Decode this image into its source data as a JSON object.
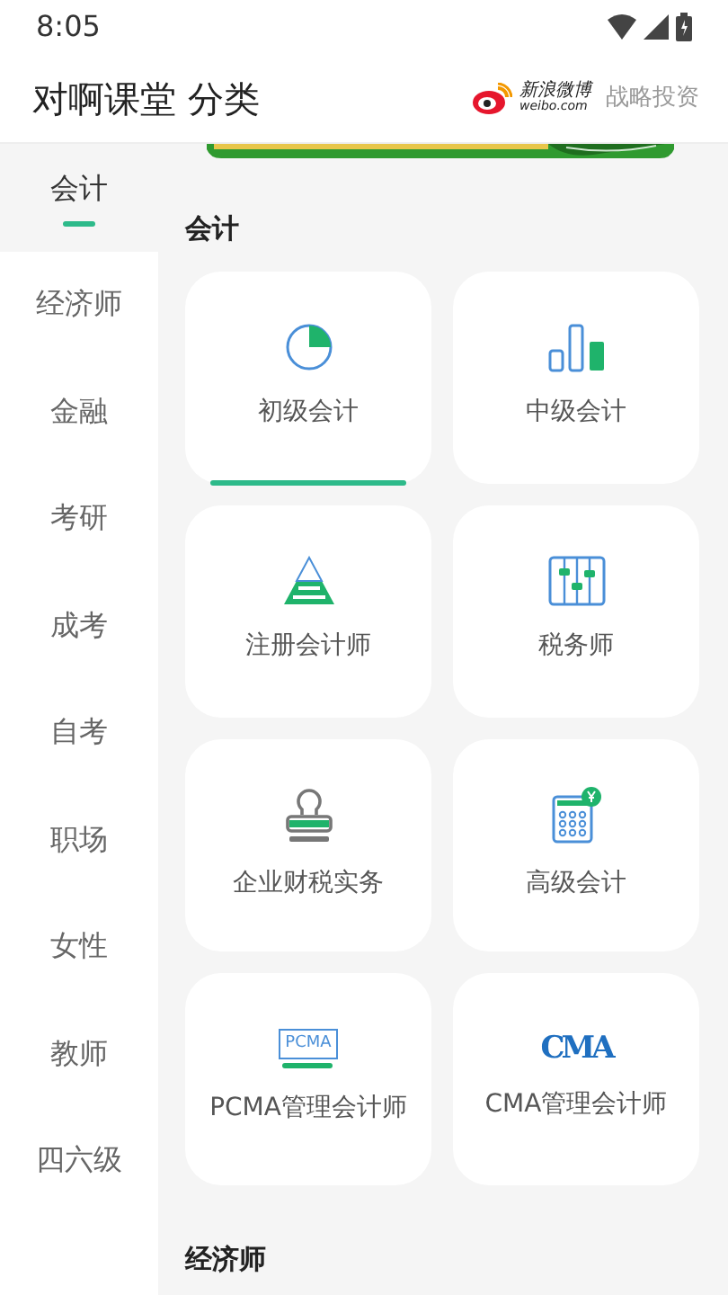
{
  "status_bar": {
    "time": "8:05"
  },
  "header": {
    "title": "对啊课堂 分类",
    "partner_logo": {
      "name": "新浪微博",
      "url": "weibo.com"
    },
    "partner_label": "战略投资"
  },
  "sidebar": {
    "items": [
      {
        "label": "会计",
        "selected": true
      },
      {
        "label": "经济师",
        "selected": false
      },
      {
        "label": "金融",
        "selected": false
      },
      {
        "label": "考研",
        "selected": false
      },
      {
        "label": "成考",
        "selected": false
      },
      {
        "label": "自考",
        "selected": false
      },
      {
        "label": "职场",
        "selected": false
      },
      {
        "label": "女性",
        "selected": false
      },
      {
        "label": "教师",
        "selected": false
      },
      {
        "label": "四六级",
        "selected": false
      }
    ]
  },
  "sections": [
    {
      "title": "会计",
      "items": [
        {
          "label": "初级会计",
          "selected": true
        },
        {
          "label": "中级会计",
          "selected": false
        },
        {
          "label": "注册会计师",
          "selected": false
        },
        {
          "label": "税务师",
          "selected": false
        },
        {
          "label": "企业财税实务",
          "selected": false
        },
        {
          "label": "高级会计",
          "selected": false
        },
        {
          "label": "PCMA管理会计师",
          "selected": false,
          "logo": "PCMA"
        },
        {
          "label": "CMA管理会计师",
          "selected": false,
          "logo": "CMA"
        }
      ]
    },
    {
      "title": "经济师"
    }
  ]
}
